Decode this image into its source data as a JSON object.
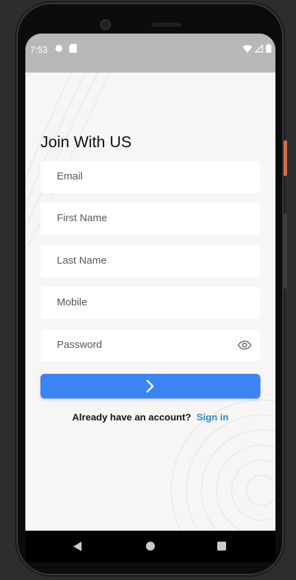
{
  "status_bar": {
    "time": "7:53"
  },
  "form": {
    "title": "Join With US",
    "fields": [
      {
        "placeholder": "Email"
      },
      {
        "placeholder": "First Name"
      },
      {
        "placeholder": "Last Name"
      },
      {
        "placeholder": "Mobile"
      },
      {
        "placeholder": "Password"
      }
    ],
    "submit_icon": "chevron-right-icon"
  },
  "footer": {
    "question": "Already have an account?",
    "link": "Sign in"
  },
  "colors": {
    "accent": "#3b84f3",
    "link": "#2a8ad8",
    "background": "#f7f6f4",
    "statusbar": "#b9b8b6"
  }
}
